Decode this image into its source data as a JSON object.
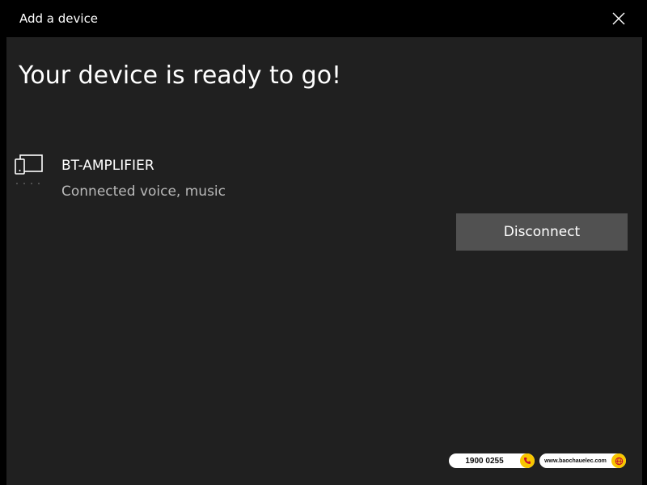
{
  "window": {
    "title": "Add a device"
  },
  "main": {
    "heading": "Your device is ready to go!"
  },
  "device": {
    "name": "BT-AMPLIFIER",
    "status": "Connected voice, music",
    "icon": "phone-tablet-icon"
  },
  "actions": {
    "disconnect_label": "Disconnect"
  },
  "footer": {
    "phone": "1900 0255",
    "website": "www.baochauelec.com"
  },
  "colors": {
    "background": "#202020",
    "titlebar": "#000000",
    "button": "#515151",
    "secondary_text": "#b9b9b9",
    "badge_accent": "#f7c600"
  }
}
